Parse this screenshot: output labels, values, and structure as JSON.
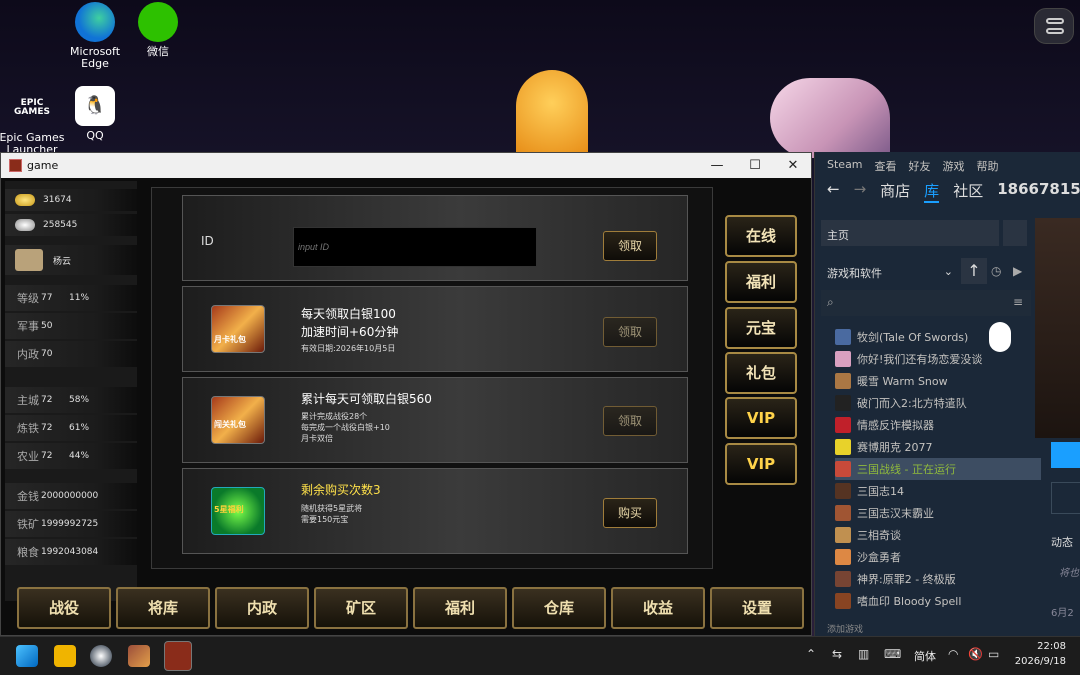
{
  "colors": {
    "accent_gold": "#e8d7a8",
    "steam_blue": "#1a9fff",
    "running_green": "#90ba3c"
  },
  "desktop": {
    "icons": [
      {
        "label": "Microsoft\nEdge",
        "icon": "edge-icon"
      },
      {
        "label": "微信",
        "icon": "wechat-icon"
      },
      {
        "label": "Epic Games\nLauncher",
        "icon": "epic-icon",
        "glyph": "EPIC\nGAMES"
      },
      {
        "label": "QQ",
        "icon": "qq-icon"
      }
    ]
  },
  "game": {
    "title": "game",
    "controls": {
      "minimize": "—",
      "maximize": "☐",
      "close": "✕"
    },
    "resources": {
      "gold": "31674",
      "silver": "258545"
    },
    "player": {
      "name": "杨云"
    },
    "stats": [
      {
        "label": "等级",
        "value": "77",
        "pct": "11%"
      },
      {
        "label": "军事",
        "value": "50",
        "pct": ""
      },
      {
        "label": "内政",
        "value": "70",
        "pct": ""
      },
      {
        "label": "主城",
        "value": "72",
        "pct": "58%"
      },
      {
        "label": "炼铁",
        "value": "72",
        "pct": "61%"
      },
      {
        "label": "农业",
        "value": "72",
        "pct": "44%"
      },
      {
        "label": "金钱",
        "value": "2000000000",
        "pct": ""
      },
      {
        "label": "铁矿",
        "value": "1999992725",
        "pct": ""
      },
      {
        "label": "粮食",
        "value": "1992043084",
        "pct": ""
      }
    ],
    "id_card": {
      "label": "ID",
      "placeholder": "input ID",
      "button": "领取"
    },
    "cards": [
      {
        "title": "每天领取白银100",
        "title2": "加速时间+60分钟",
        "lines": [
          "有效日期:2026年10月5日"
        ],
        "button": "领取",
        "badge": "月卡礼包"
      },
      {
        "title": "累计每天可领取白银560",
        "title2": "",
        "lines": [
          "累计完成战役28个",
          "每完成一个战役白银+10",
          "月卡双倍"
        ],
        "button": "领取",
        "badge": "闯关礼包"
      },
      {
        "title": "剩余购买次数3",
        "title2": "",
        "lines": [
          "随机获得5星武将",
          "需要150元宝"
        ],
        "button": "购买",
        "badge": "5星福利"
      }
    ],
    "side_buttons": [
      "在线",
      "福利",
      "元宝",
      "礼包",
      "VIP",
      "VIP"
    ],
    "bottom_tabs": [
      "战役",
      "将库",
      "内政",
      "矿区",
      "福利",
      "仓库",
      "收益",
      "设置"
    ]
  },
  "steam": {
    "menu": [
      "Steam",
      "查看",
      "好友",
      "游戏",
      "帮助"
    ],
    "nav": [
      "商店",
      "库",
      "社区",
      "18667815"
    ],
    "home": "主页",
    "filter": "游戏和软件",
    "games": [
      "牧剑(Tale Of Swords)",
      "你好!我们还有场恋爱没谈",
      "暖雪 Warm Snow",
      "破门而入2:北方特遣队",
      "情感反诈模拟器",
      "赛博朋克 2077",
      "三国战线 - 正在运行",
      "三国志14",
      "三国志汉末霸业",
      "三相奇谈",
      "沙盒勇者",
      "神界:原罪2 - 终极版",
      "嗜血印 Bloody Spell"
    ],
    "add_game": "添加游戏",
    "right_text": [
      "动态",
      "将也"
    ],
    "date_partial": "6月2"
  },
  "taskbar": {
    "ime": "简体",
    "time": "22:08",
    "date": "2026/9/18"
  }
}
